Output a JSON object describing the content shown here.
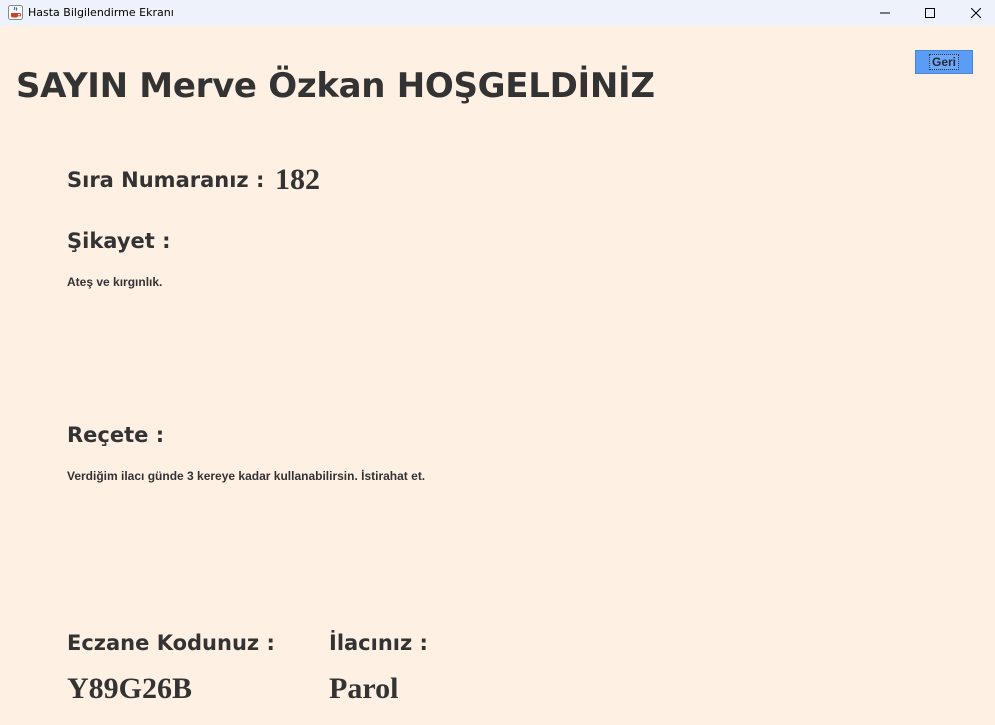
{
  "window": {
    "title": "Hasta Bilgilendirme Ekranı",
    "icon": "java-cup-icon",
    "controls": [
      "minimize-icon",
      "maximize-icon",
      "close-icon"
    ]
  },
  "toolbar": {
    "back_label": "Geri"
  },
  "header": {
    "welcome": "SAYIN Merve Özkan HOŞGELDİNİZ"
  },
  "queue": {
    "label": "Sıra Numaranız :",
    "value": "182"
  },
  "complaint": {
    "label": "Şikayet :",
    "text": "Ateş ve kırgınlık."
  },
  "prescription": {
    "label": "Reçete :",
    "text": "Verdiğim ilacı günde 3 kereye kadar kullanabilirsin. İstirahat et."
  },
  "pharmacy": {
    "label": "Eczane Kodunuz :",
    "value": "Y89G26B"
  },
  "medicine": {
    "label": "İlacınız :",
    "value": "Parol"
  },
  "colors": {
    "background": "#fff0e4",
    "titlebar": "#eef2fa",
    "button": "#5b9cf5",
    "text": "#333333"
  }
}
